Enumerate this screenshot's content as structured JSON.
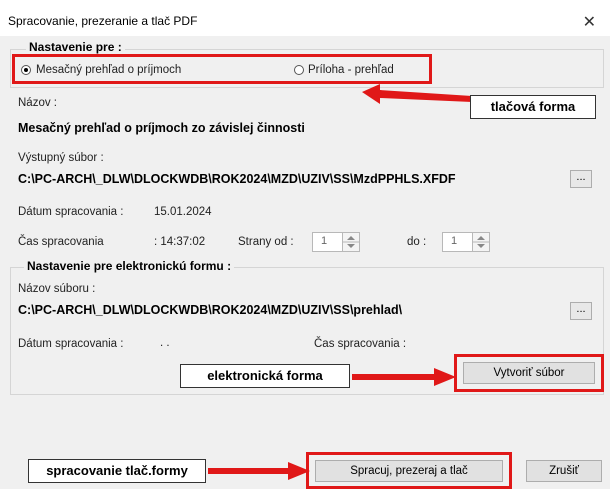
{
  "window": {
    "title": "Spracovanie, prezeranie a tlač PDF",
    "close_glyph": "✕"
  },
  "group_print": {
    "legend": "Nastavenie pre :"
  },
  "radio_monthly": {
    "label": "Mesačný prehľad o príjmoch",
    "checked": true
  },
  "radio_attachment": {
    "label": "Príloha - prehľad",
    "checked": false
  },
  "callout_print": "tlačová forma",
  "name_section": {
    "label": "Názov :",
    "value": "Mesačný prehľad o príjmoch zo závislej činnosti"
  },
  "output_file": {
    "label": "Výstupný súbor :",
    "value": "C:\\PC-ARCH\\_DLW\\DLOCKWDB\\ROK2024\\MZD\\UZIV\\SS\\MzdPPHLS.XFDF",
    "browse": "..."
  },
  "processing_date": {
    "label": "Dátum spracovania :",
    "value": "15.01.2024"
  },
  "processing_time": {
    "label": "Čas spracovania",
    "value": ": 14:37:02"
  },
  "pages_from": {
    "label": "Strany od :",
    "value": "1"
  },
  "pages_to": {
    "label": "do :",
    "value": "1"
  },
  "group_electronic": {
    "legend": "Nastavenie pre elektronickú formu :"
  },
  "file_name": {
    "label": "Názov súboru :",
    "value": "C:\\PC-ARCH\\_DLW\\DLOCKWDB\\ROK2024\\MZD\\UZIV\\SS\\prehlad\\",
    "browse": "..."
  },
  "e_date": {
    "label": "Dátum spracovania :",
    "value": ". ."
  },
  "e_time": {
    "label": "Čas spracovania :"
  },
  "callout_electronic": "elektronická forma",
  "create_file_button": "Vytvoriť súbor",
  "callout_processing": "spracovanie tlač.formy",
  "process_button": "Spracuj, prezeraj a tlač",
  "cancel_button": "Zrušiť",
  "colors": {
    "highlight_red": "#e01818",
    "dialog_bg": "#f0f0f0"
  }
}
